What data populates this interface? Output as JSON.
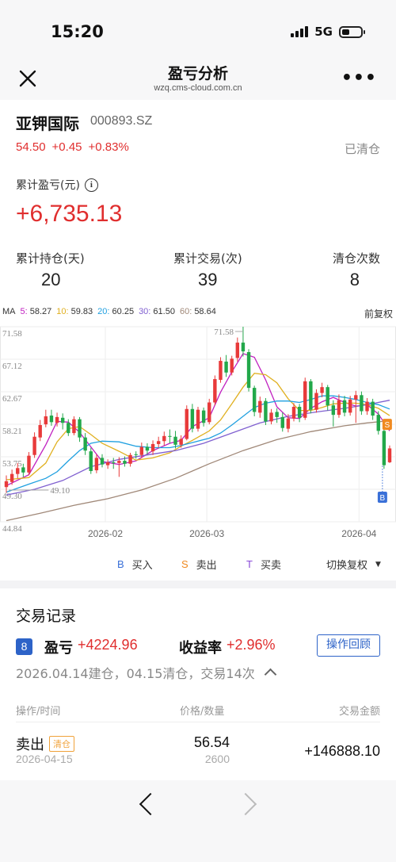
{
  "status": {
    "time": "15:20",
    "network": "5G"
  },
  "nav": {
    "title": "盈亏分析",
    "url": "wzq.cms-cloud.com.cn"
  },
  "stock": {
    "name": "亚钾国际",
    "code": "000893.SZ",
    "price": "54.50",
    "change": "+0.45",
    "change_pct": "+0.83%",
    "status": "已清仓"
  },
  "summary": {
    "cum_label": "累计盈亏(元)",
    "cum_value": "+6,735.13",
    "stats": [
      {
        "label": "累计持仓(天)",
        "value": "20"
      },
      {
        "label": "累计交易(次)",
        "value": "39"
      },
      {
        "label": "清仓次数",
        "value": "8"
      }
    ]
  },
  "ma": {
    "prefix": "MA",
    "items": [
      {
        "k": "5:",
        "v": "58.27",
        "color": "#c020c0"
      },
      {
        "k": "10:",
        "v": "59.83",
        "color": "#e0b020"
      },
      {
        "k": "20:",
        "v": "60.25",
        "color": "#20a0e0"
      },
      {
        "k": "30:",
        "v": "61.50",
        "color": "#8060d0"
      },
      {
        "k": "60:",
        "v": "58.64",
        "color": "#a08878"
      }
    ],
    "adjust": "前复权"
  },
  "chart_data": {
    "type": "candlestick",
    "y_ticks": [
      "71.58",
      "67.12",
      "62.67",
      "58.21",
      "53.75",
      "49.30",
      "44.84"
    ],
    "x_ticks": [
      "2026-02",
      "2026-03",
      "2026-04"
    ],
    "high_label": "71.58",
    "low_label": "49.10",
    "markers": [
      "S",
      "B"
    ],
    "up_color": "#e83a3a",
    "down_color": "#22a84a",
    "candles": [
      [
        49.6,
        50.4,
        48.8,
        51.2
      ],
      [
        50.3,
        51.4,
        49.9,
        52.0
      ],
      [
        51.4,
        52.2,
        50.8,
        52.9
      ],
      [
        52.3,
        51.6,
        51.0,
        52.8
      ],
      [
        51.6,
        53.9,
        51.2,
        54.4
      ],
      [
        54.0,
        56.5,
        53.6,
        57.1
      ],
      [
        56.4,
        58.1,
        55.9,
        58.8
      ],
      [
        58.2,
        59.3,
        57.8,
        60.2
      ],
      [
        59.4,
        58.5,
        58.0,
        60.2
      ],
      [
        58.4,
        59.2,
        57.9,
        59.8
      ],
      [
        59.1,
        58.4,
        57.5,
        59.7
      ],
      [
        58.4,
        57.0,
        56.6,
        58.9
      ],
      [
        57.0,
        58.9,
        56.7,
        59.3
      ],
      [
        58.9,
        56.4,
        55.8,
        59.2
      ],
      [
        56.4,
        54.6,
        54.0,
        57.0
      ],
      [
        54.5,
        51.8,
        51.4,
        55.0
      ],
      [
        51.9,
        53.6,
        51.5,
        54.1
      ],
      [
        53.6,
        52.7,
        52.3,
        54.1
      ],
      [
        52.6,
        53.0,
        52.1,
        53.4
      ],
      [
        53.0,
        52.9,
        52.1,
        53.6
      ],
      [
        52.9,
        53.2,
        51.0,
        53.7
      ],
      [
        53.2,
        52.8,
        52.4,
        53.8
      ],
      [
        52.8,
        54.0,
        52.4,
        54.3
      ],
      [
        54.1,
        54.0,
        53.5,
        54.5
      ],
      [
        54.0,
        55.1,
        53.6,
        55.7
      ],
      [
        55.1,
        54.6,
        54.1,
        55.6
      ],
      [
        54.5,
        55.5,
        54.0,
        56.0
      ],
      [
        55.5,
        55.9,
        55.0,
        56.5
      ],
      [
        55.9,
        56.6,
        55.3,
        57.2
      ],
      [
        56.6,
        56.5,
        55.6,
        57.5
      ],
      [
        56.5,
        55.4,
        54.9,
        57.3
      ],
      [
        55.4,
        56.2,
        55.0,
        56.7
      ],
      [
        56.2,
        60.3,
        56.0,
        60.8
      ],
      [
        60.3,
        57.6,
        57.1,
        61.0
      ],
      [
        57.6,
        60.2,
        57.2,
        60.6
      ],
      [
        60.1,
        58.4,
        57.9,
        60.5
      ],
      [
        58.5,
        61.2,
        58.2,
        61.7
      ],
      [
        61.2,
        64.4,
        60.8,
        64.9
      ],
      [
        64.3,
        66.9,
        63.9,
        67.4
      ],
      [
        66.8,
        65.3,
        64.7,
        67.7
      ],
      [
        65.3,
        67.2,
        64.9,
        67.6
      ],
      [
        67.3,
        69.4,
        66.8,
        70.1
      ],
      [
        69.4,
        68.2,
        67.5,
        71.58
      ],
      [
        68.1,
        63.2,
        62.7,
        68.5
      ],
      [
        63.2,
        59.9,
        59.3,
        63.5
      ],
      [
        59.8,
        61.4,
        59.1,
        62.0
      ],
      [
        61.4,
        58.6,
        58.1,
        61.8
      ],
      [
        58.6,
        59.8,
        58.2,
        60.3
      ],
      [
        59.9,
        59.2,
        58.4,
        60.4
      ],
      [
        59.2,
        57.7,
        57.2,
        59.8
      ],
      [
        57.6,
        59.0,
        57.1,
        59.6
      ],
      [
        59.0,
        60.6,
        58.6,
        61.1
      ],
      [
        60.6,
        59.1,
        58.5,
        61.0
      ],
      [
        59.1,
        64.1,
        58.8,
        64.6
      ],
      [
        64.1,
        60.2,
        59.7,
        64.4
      ],
      [
        60.2,
        62.5,
        59.8,
        63.0
      ],
      [
        62.5,
        63.3,
        61.9,
        63.9
      ],
      [
        63.3,
        60.8,
        60.1,
        63.6
      ],
      [
        60.8,
        59.5,
        57.9,
        61.5
      ],
      [
        59.5,
        61.5,
        59.1,
        62.3
      ],
      [
        61.5,
        59.8,
        59.3,
        62.1
      ],
      [
        59.8,
        61.6,
        59.4,
        62.1
      ],
      [
        61.6,
        62.2,
        58.4,
        62.8
      ],
      [
        62.2,
        60.0,
        59.5,
        62.7
      ],
      [
        60.0,
        61.3,
        59.5,
        61.8
      ],
      [
        61.3,
        59.4,
        58.8,
        61.7
      ],
      [
        59.5,
        57.3,
        56.8,
        60.0
      ],
      [
        57.3,
        52.6,
        52.1,
        57.6
      ],
      [
        53.0,
        54.9,
        52.9,
        55.3
      ]
    ],
    "ma_series": [
      {
        "name": "5",
        "color": "#c020c0",
        "values": [
          [
            0,
            49.8
          ],
          [
            4,
            51.3
          ],
          [
            7,
            55.4
          ],
          [
            9,
            58.6
          ],
          [
            11,
            58.5
          ],
          [
            13,
            57.1
          ],
          [
            15,
            55.1
          ],
          [
            17,
            53.1
          ],
          [
            20,
            52.7
          ],
          [
            23,
            53.2
          ],
          [
            26,
            54.6
          ],
          [
            29,
            55.6
          ],
          [
            31,
            56.0
          ],
          [
            33,
            57.9
          ],
          [
            36,
            59.1
          ],
          [
            38,
            62.6
          ],
          [
            40,
            65.4
          ],
          [
            42,
            67.9
          ],
          [
            44,
            67.4
          ],
          [
            46,
            64.3
          ],
          [
            48,
            60.6
          ],
          [
            50,
            59.1
          ],
          [
            52,
            59.0
          ],
          [
            54,
            60.4
          ],
          [
            56,
            61.3
          ],
          [
            58,
            61.9
          ],
          [
            60,
            61.2
          ],
          [
            62,
            60.7
          ],
          [
            64,
            60.9
          ],
          [
            66,
            59.6
          ],
          [
            68,
            57.3
          ]
        ]
      },
      {
        "name": "10",
        "color": "#e0b020",
        "values": [
          [
            0,
            50.6
          ],
          [
            4,
            50.9
          ],
          [
            7,
            52.9
          ],
          [
            9,
            55.8
          ],
          [
            11,
            57.6
          ],
          [
            13,
            57.9
          ],
          [
            15,
            56.8
          ],
          [
            17,
            55.6
          ],
          [
            20,
            54.5
          ],
          [
            23,
            53.3
          ],
          [
            26,
            53.6
          ],
          [
            29,
            54.3
          ],
          [
            31,
            55.2
          ],
          [
            33,
            56.0
          ],
          [
            36,
            57.3
          ],
          [
            38,
            58.8
          ],
          [
            40,
            61.0
          ],
          [
            42,
            63.3
          ],
          [
            44,
            65.2
          ],
          [
            46,
            65.0
          ],
          [
            48,
            63.9
          ],
          [
            50,
            61.7
          ],
          [
            52,
            60.1
          ],
          [
            54,
            60.1
          ],
          [
            56,
            60.5
          ],
          [
            58,
            61.0
          ],
          [
            60,
            61.1
          ],
          [
            62,
            61.1
          ],
          [
            64,
            60.9
          ],
          [
            66,
            60.4
          ],
          [
            68,
            59.4
          ]
        ]
      },
      {
        "name": "20",
        "color": "#20a0e0",
        "values": [
          [
            0,
            48.9
          ],
          [
            4,
            50.0
          ],
          [
            7,
            50.8
          ],
          [
            9,
            51.7
          ],
          [
            11,
            53.2
          ],
          [
            13,
            54.6
          ],
          [
            15,
            55.6
          ],
          [
            17,
            55.9
          ],
          [
            20,
            55.8
          ],
          [
            23,
            55.2
          ],
          [
            26,
            55.0
          ],
          [
            29,
            55.0
          ],
          [
            31,
            55.3
          ],
          [
            33,
            55.7
          ],
          [
            36,
            56.3
          ],
          [
            38,
            57.0
          ],
          [
            40,
            58.1
          ],
          [
            42,
            59.3
          ],
          [
            44,
            60.5
          ],
          [
            46,
            61.1
          ],
          [
            48,
            61.4
          ],
          [
            50,
            61.4
          ],
          [
            52,
            61.2
          ],
          [
            54,
            61.6
          ],
          [
            56,
            62.1
          ],
          [
            58,
            62.1
          ],
          [
            60,
            61.9
          ],
          [
            62,
            61.6
          ],
          [
            64,
            61.2
          ],
          [
            66,
            60.9
          ],
          [
            68,
            60.3
          ]
        ]
      },
      {
        "name": "30",
        "color": "#8060d0",
        "values": [
          [
            0,
            48.5
          ],
          [
            5,
            49.3
          ],
          [
            10,
            50.5
          ],
          [
            15,
            52.4
          ],
          [
            20,
            53.4
          ],
          [
            25,
            54.0
          ],
          [
            30,
            54.6
          ],
          [
            35,
            55.6
          ],
          [
            40,
            57.0
          ],
          [
            45,
            58.4
          ],
          [
            50,
            59.3
          ],
          [
            55,
            59.9
          ],
          [
            60,
            60.4
          ],
          [
            64,
            60.9
          ],
          [
            68,
            61.5
          ]
        ]
      },
      {
        "name": "60",
        "color": "#a08878",
        "values": [
          [
            0,
            45.0
          ],
          [
            6,
            46.0
          ],
          [
            12,
            47.1
          ],
          [
            18,
            48.0
          ],
          [
            24,
            49.2
          ],
          [
            30,
            50.8
          ],
          [
            36,
            52.8
          ],
          [
            42,
            54.6
          ],
          [
            48,
            56.1
          ],
          [
            54,
            57.2
          ],
          [
            60,
            58.0
          ],
          [
            64,
            58.4
          ],
          [
            68,
            58.7
          ]
        ]
      }
    ]
  },
  "legend": {
    "buy": {
      "key": "B",
      "label": "买入",
      "color": "#3a70d8"
    },
    "sell": {
      "key": "S",
      "label": "卖出",
      "color": "#f08a20"
    },
    "trade": {
      "key": "T",
      "label": "买卖",
      "color": "#8a4ad8"
    },
    "switch": "切换复权"
  },
  "records": {
    "title": "交易记录",
    "badge": "8",
    "pl_label": "盈亏",
    "pl_value": "+4224.96",
    "rate_label": "收益率",
    "rate_value": "+2.96%",
    "replay": "操作回顾",
    "sub": "2026.04.14建仓，04.15清仓，交易14次",
    "headers": {
      "op": "操作/时间",
      "pq": "价格/数量",
      "amt": "交易金额"
    },
    "row": {
      "action": "卖出",
      "tag": "清仓",
      "date": "2026-04-15",
      "price": "56.54",
      "qty": "2600",
      "amount": "+146888.10"
    }
  }
}
